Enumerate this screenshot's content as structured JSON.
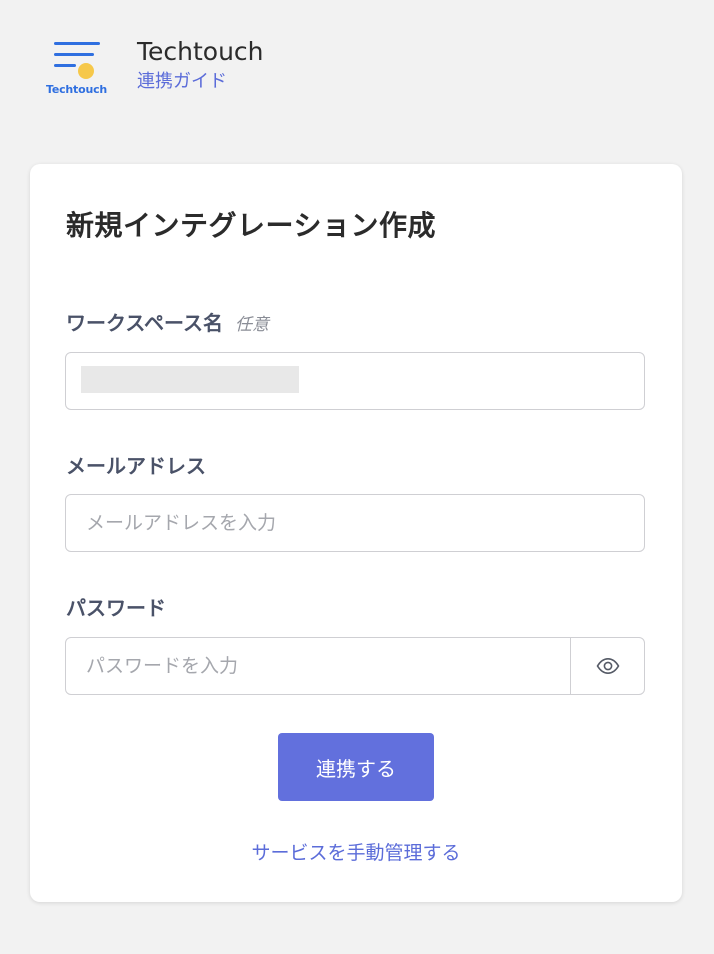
{
  "header": {
    "logo_text": "Techtouch",
    "brand_name": "Techtouch",
    "subtitle": "連携ガイド"
  },
  "form": {
    "title": "新規インテグレーション作成",
    "workspace": {
      "label": "ワークスペース名",
      "optional": "任意",
      "value": ""
    },
    "email": {
      "label": "メールアドレス",
      "placeholder": "メールアドレスを入力"
    },
    "password": {
      "label": "パスワード",
      "placeholder": "パスワードを入力"
    },
    "submit_label": "連携する",
    "manual_link": "サービスを手動管理する"
  },
  "colors": {
    "accent": "#6270dd",
    "link": "#5b6cd9",
    "logo_blue": "#2f6fe0",
    "logo_yellow": "#f6c84a",
    "background": "#f2f2f2"
  },
  "icons": {
    "password_toggle": "eye-icon"
  }
}
